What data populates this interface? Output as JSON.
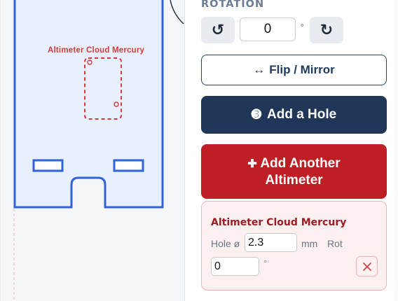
{
  "canvas": {
    "part_label": "Altimeter Cloud Mercury"
  },
  "panel": {
    "rotation": {
      "label": "ROTATION",
      "value": "0",
      "unit": "°",
      "rotate_left_icon": "↺",
      "rotate_right_icon": "↻"
    },
    "flip_button": {
      "icon": "↔",
      "label": "Flip / Mirror"
    },
    "add_hole_button": {
      "icon": "➌",
      "label": "Add a Hole"
    },
    "add_altimeter_button": {
      "icon": "✚",
      "line1": "Add Another",
      "line2": "Altimeter"
    },
    "altimeter_card": {
      "title": "Altimeter Cloud Mercury",
      "hole_label": "Hole ø",
      "hole_value": "2.3",
      "hole_unit": "mm",
      "rot_label": "Rot",
      "rot_value": "0",
      "rot_unit": "°",
      "remove_icon": "×"
    }
  },
  "colors": {
    "outline_blue": "#2f63d6",
    "part_fill": "#e7f0fc",
    "accent_red": "#be1e24",
    "navy": "#1f3658",
    "label_red": "#d9383d"
  }
}
